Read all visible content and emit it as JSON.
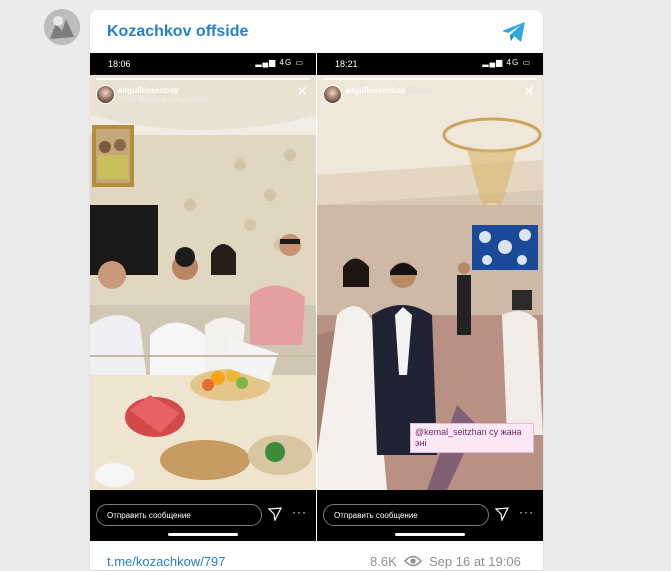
{
  "channel": {
    "title": "Kozachkov offside",
    "accent": "#2481cc"
  },
  "stories": [
    {
      "status_time": "18:06",
      "status_signal": "4G",
      "username": "aitgulbissenbay",
      "posted": "5ч.",
      "music": "♪ Pure Beauty от yolla_hakman",
      "reply_placeholder": "Отправить сообщение",
      "close_icon": "close-icon",
      "send_icon": "send-icon",
      "more_icon": "more-icon"
    },
    {
      "status_time": "18:21",
      "status_signal": "4G",
      "username": "aitgulbissenbay",
      "posted": "58мин.",
      "tag_text": "@kemal_seitzhan су жана эні",
      "reply_placeholder": "Отправить сообщение",
      "close_icon": "close-icon",
      "send_icon": "send-icon",
      "more_icon": "more-icon"
    }
  ],
  "footer": {
    "link": "t.me/kozachkow/797",
    "views": "8.6K",
    "date": "Sep 16 at 19:06"
  }
}
